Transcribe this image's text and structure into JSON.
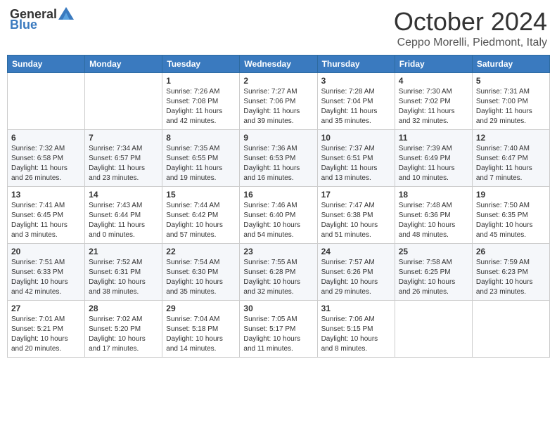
{
  "logo": {
    "text_general": "General",
    "text_blue": "Blue"
  },
  "header": {
    "month": "October 2024",
    "location": "Ceppo Morelli, Piedmont, Italy"
  },
  "weekdays": [
    "Sunday",
    "Monday",
    "Tuesday",
    "Wednesday",
    "Thursday",
    "Friday",
    "Saturday"
  ],
  "weeks": [
    [
      {
        "day": "",
        "sunrise": "",
        "sunset": "",
        "daylight": ""
      },
      {
        "day": "",
        "sunrise": "",
        "sunset": "",
        "daylight": ""
      },
      {
        "day": "1",
        "sunrise": "Sunrise: 7:26 AM",
        "sunset": "Sunset: 7:08 PM",
        "daylight": "Daylight: 11 hours and 42 minutes."
      },
      {
        "day": "2",
        "sunrise": "Sunrise: 7:27 AM",
        "sunset": "Sunset: 7:06 PM",
        "daylight": "Daylight: 11 hours and 39 minutes."
      },
      {
        "day": "3",
        "sunrise": "Sunrise: 7:28 AM",
        "sunset": "Sunset: 7:04 PM",
        "daylight": "Daylight: 11 hours and 35 minutes."
      },
      {
        "day": "4",
        "sunrise": "Sunrise: 7:30 AM",
        "sunset": "Sunset: 7:02 PM",
        "daylight": "Daylight: 11 hours and 32 minutes."
      },
      {
        "day": "5",
        "sunrise": "Sunrise: 7:31 AM",
        "sunset": "Sunset: 7:00 PM",
        "daylight": "Daylight: 11 hours and 29 minutes."
      }
    ],
    [
      {
        "day": "6",
        "sunrise": "Sunrise: 7:32 AM",
        "sunset": "Sunset: 6:58 PM",
        "daylight": "Daylight: 11 hours and 26 minutes."
      },
      {
        "day": "7",
        "sunrise": "Sunrise: 7:34 AM",
        "sunset": "Sunset: 6:57 PM",
        "daylight": "Daylight: 11 hours and 23 minutes."
      },
      {
        "day": "8",
        "sunrise": "Sunrise: 7:35 AM",
        "sunset": "Sunset: 6:55 PM",
        "daylight": "Daylight: 11 hours and 19 minutes."
      },
      {
        "day": "9",
        "sunrise": "Sunrise: 7:36 AM",
        "sunset": "Sunset: 6:53 PM",
        "daylight": "Daylight: 11 hours and 16 minutes."
      },
      {
        "day": "10",
        "sunrise": "Sunrise: 7:37 AM",
        "sunset": "Sunset: 6:51 PM",
        "daylight": "Daylight: 11 hours and 13 minutes."
      },
      {
        "day": "11",
        "sunrise": "Sunrise: 7:39 AM",
        "sunset": "Sunset: 6:49 PM",
        "daylight": "Daylight: 11 hours and 10 minutes."
      },
      {
        "day": "12",
        "sunrise": "Sunrise: 7:40 AM",
        "sunset": "Sunset: 6:47 PM",
        "daylight": "Daylight: 11 hours and 7 minutes."
      }
    ],
    [
      {
        "day": "13",
        "sunrise": "Sunrise: 7:41 AM",
        "sunset": "Sunset: 6:45 PM",
        "daylight": "Daylight: 11 hours and 3 minutes."
      },
      {
        "day": "14",
        "sunrise": "Sunrise: 7:43 AM",
        "sunset": "Sunset: 6:44 PM",
        "daylight": "Daylight: 11 hours and 0 minutes."
      },
      {
        "day": "15",
        "sunrise": "Sunrise: 7:44 AM",
        "sunset": "Sunset: 6:42 PM",
        "daylight": "Daylight: 10 hours and 57 minutes."
      },
      {
        "day": "16",
        "sunrise": "Sunrise: 7:46 AM",
        "sunset": "Sunset: 6:40 PM",
        "daylight": "Daylight: 10 hours and 54 minutes."
      },
      {
        "day": "17",
        "sunrise": "Sunrise: 7:47 AM",
        "sunset": "Sunset: 6:38 PM",
        "daylight": "Daylight: 10 hours and 51 minutes."
      },
      {
        "day": "18",
        "sunrise": "Sunrise: 7:48 AM",
        "sunset": "Sunset: 6:36 PM",
        "daylight": "Daylight: 10 hours and 48 minutes."
      },
      {
        "day": "19",
        "sunrise": "Sunrise: 7:50 AM",
        "sunset": "Sunset: 6:35 PM",
        "daylight": "Daylight: 10 hours and 45 minutes."
      }
    ],
    [
      {
        "day": "20",
        "sunrise": "Sunrise: 7:51 AM",
        "sunset": "Sunset: 6:33 PM",
        "daylight": "Daylight: 10 hours and 42 minutes."
      },
      {
        "day": "21",
        "sunrise": "Sunrise: 7:52 AM",
        "sunset": "Sunset: 6:31 PM",
        "daylight": "Daylight: 10 hours and 38 minutes."
      },
      {
        "day": "22",
        "sunrise": "Sunrise: 7:54 AM",
        "sunset": "Sunset: 6:30 PM",
        "daylight": "Daylight: 10 hours and 35 minutes."
      },
      {
        "day": "23",
        "sunrise": "Sunrise: 7:55 AM",
        "sunset": "Sunset: 6:28 PM",
        "daylight": "Daylight: 10 hours and 32 minutes."
      },
      {
        "day": "24",
        "sunrise": "Sunrise: 7:57 AM",
        "sunset": "Sunset: 6:26 PM",
        "daylight": "Daylight: 10 hours and 29 minutes."
      },
      {
        "day": "25",
        "sunrise": "Sunrise: 7:58 AM",
        "sunset": "Sunset: 6:25 PM",
        "daylight": "Daylight: 10 hours and 26 minutes."
      },
      {
        "day": "26",
        "sunrise": "Sunrise: 7:59 AM",
        "sunset": "Sunset: 6:23 PM",
        "daylight": "Daylight: 10 hours and 23 minutes."
      }
    ],
    [
      {
        "day": "27",
        "sunrise": "Sunrise: 7:01 AM",
        "sunset": "Sunset: 5:21 PM",
        "daylight": "Daylight: 10 hours and 20 minutes."
      },
      {
        "day": "28",
        "sunrise": "Sunrise: 7:02 AM",
        "sunset": "Sunset: 5:20 PM",
        "daylight": "Daylight: 10 hours and 17 minutes."
      },
      {
        "day": "29",
        "sunrise": "Sunrise: 7:04 AM",
        "sunset": "Sunset: 5:18 PM",
        "daylight": "Daylight: 10 hours and 14 minutes."
      },
      {
        "day": "30",
        "sunrise": "Sunrise: 7:05 AM",
        "sunset": "Sunset: 5:17 PM",
        "daylight": "Daylight: 10 hours and 11 minutes."
      },
      {
        "day": "31",
        "sunrise": "Sunrise: 7:06 AM",
        "sunset": "Sunset: 5:15 PM",
        "daylight": "Daylight: 10 hours and 8 minutes."
      },
      {
        "day": "",
        "sunrise": "",
        "sunset": "",
        "daylight": ""
      },
      {
        "day": "",
        "sunrise": "",
        "sunset": "",
        "daylight": ""
      }
    ]
  ]
}
